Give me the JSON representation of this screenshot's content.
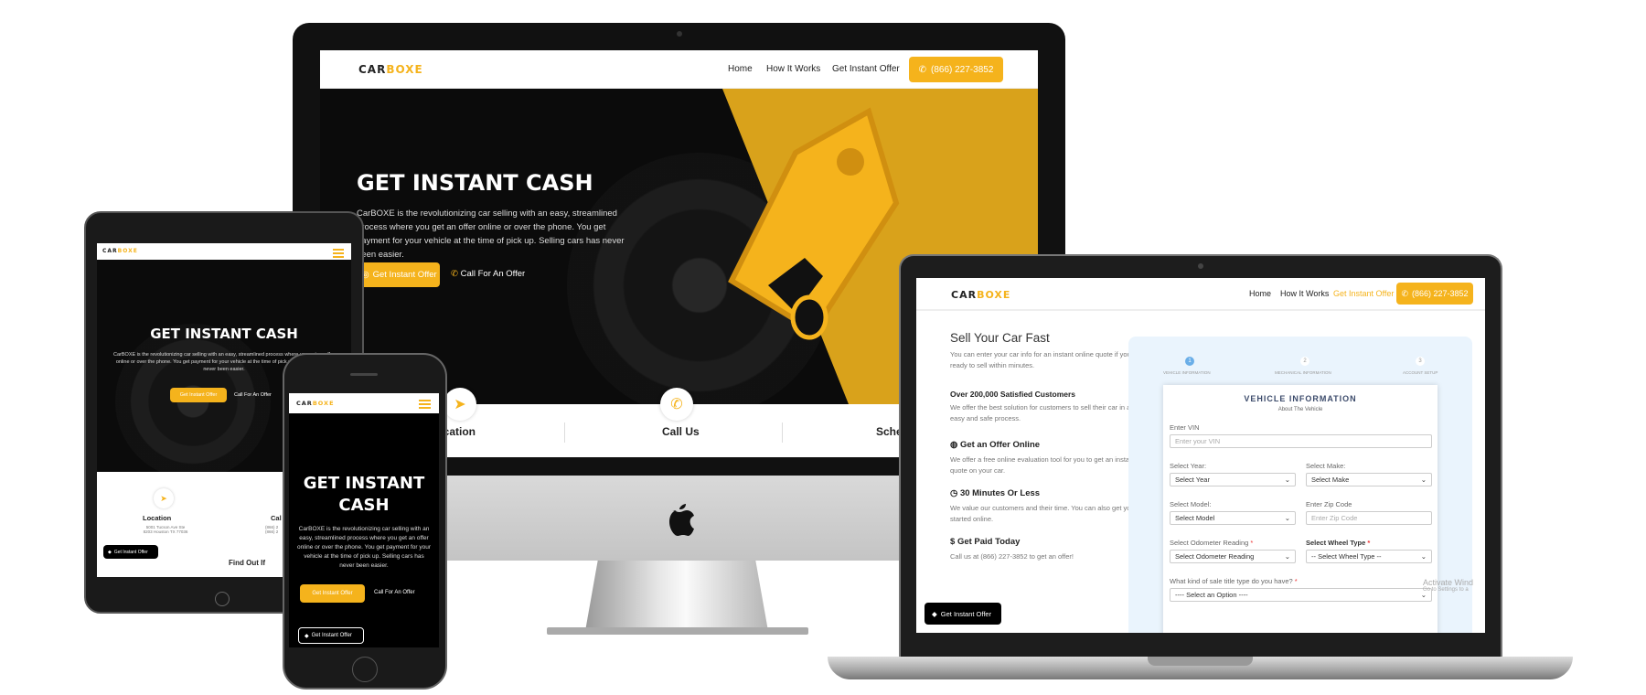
{
  "logo": {
    "part1": "CAR",
    "part2": "BOXE"
  },
  "nav": {
    "home": "Home",
    "how": "How It Works",
    "offer": "Get Instant Offer",
    "phone": "(866) 227-3852"
  },
  "hero": {
    "title": "GET INSTANT CASH",
    "body_desktop": "CarBOXE is the revolutionizing car selling with an easy, streamlined process where you get an offer online or over the phone. You get payment for your vehicle at the time of pick up. Selling cars has never been easier.",
    "body_tablet": "CarBOXE is the revolutionizing car selling with an easy, streamlined process where you get an offer online or over the phone. You get payment for your vehicle at the time of pick up. Selling cars has never been easier.",
    "body_phone": "CarBOXE is the revolutionizing car selling with an easy, streamlined process where you get an offer online or over the phone. You get payment for your vehicle at the time of pick up. Selling cars has never been easier.",
    "title_phone_l1": "GET INSTANT",
    "title_phone_l2": "CASH",
    "cta_offer": "Get Instant Offer",
    "cta_call": "Call For An Offer"
  },
  "features": {
    "location": "Location",
    "call": "Call Us",
    "schedule": "Sche",
    "location_full": "Location",
    "location_addr1": "5001 Tucson Ave Ste",
    "location_addr2": "8203 Houston TX 77036",
    "call_short": "Cal",
    "call_line1": "(866) 2",
    "call_line2": "(866) 2",
    "find_out": "Find Out If"
  },
  "sticky": {
    "offer": "Get Instant Offer"
  },
  "laptop": {
    "sell_title": "Sell Your Car Fast",
    "sell_desc": "You can enter your car info for an instant online quote if you are ready to sell within minutes.",
    "customers_title": "Over 200,000 Satisfied Customers",
    "customers_desc": "We offer the best solution for customers to sell their car in a quick, easy and safe process.",
    "online_title": "Get an Offer Online",
    "online_desc": "We offer a free online evaluation tool for you to get an instant quote on your car.",
    "minutes_title": "30 Minutes Or Less",
    "minutes_desc": "We value our customers and their time. You can also get your offer started online.",
    "paid_title": "Get Paid Today",
    "paid_desc": "Call us at (866) 227-3852 to get an offer!",
    "steps": [
      "VEHICLE INFORMATION",
      "MECHANICAL INFORMATION",
      "ACCOUNT SETUP"
    ],
    "step_nums": [
      "1",
      "2",
      "3"
    ],
    "form_title": "VEHICLE INFORMATION",
    "form_sub": "About The Vehicle",
    "vin_label": "Enter VIN",
    "vin_ph": "Enter your VIN",
    "year_label": "Select Year:",
    "year_val": "Select Year",
    "make_label": "Select Make:",
    "make_val": "Select Make",
    "model_label": "Select Model:",
    "model_val": "Select Model",
    "zip_label": "Enter Zip Code",
    "zip_ph": "Enter Zip Code",
    "odo_label": "Select Odometer Reading",
    "odo_val": "Select Odometer Reading",
    "wheel_label": "Select Wheel Type",
    "wheel_val": "-- Select Wheel Type --",
    "title_label": "What kind of sale title type do you have?",
    "title_val": "---- Select an Option ----",
    "activate1": "Activate Wind",
    "activate2": "Go to Settings to a"
  }
}
